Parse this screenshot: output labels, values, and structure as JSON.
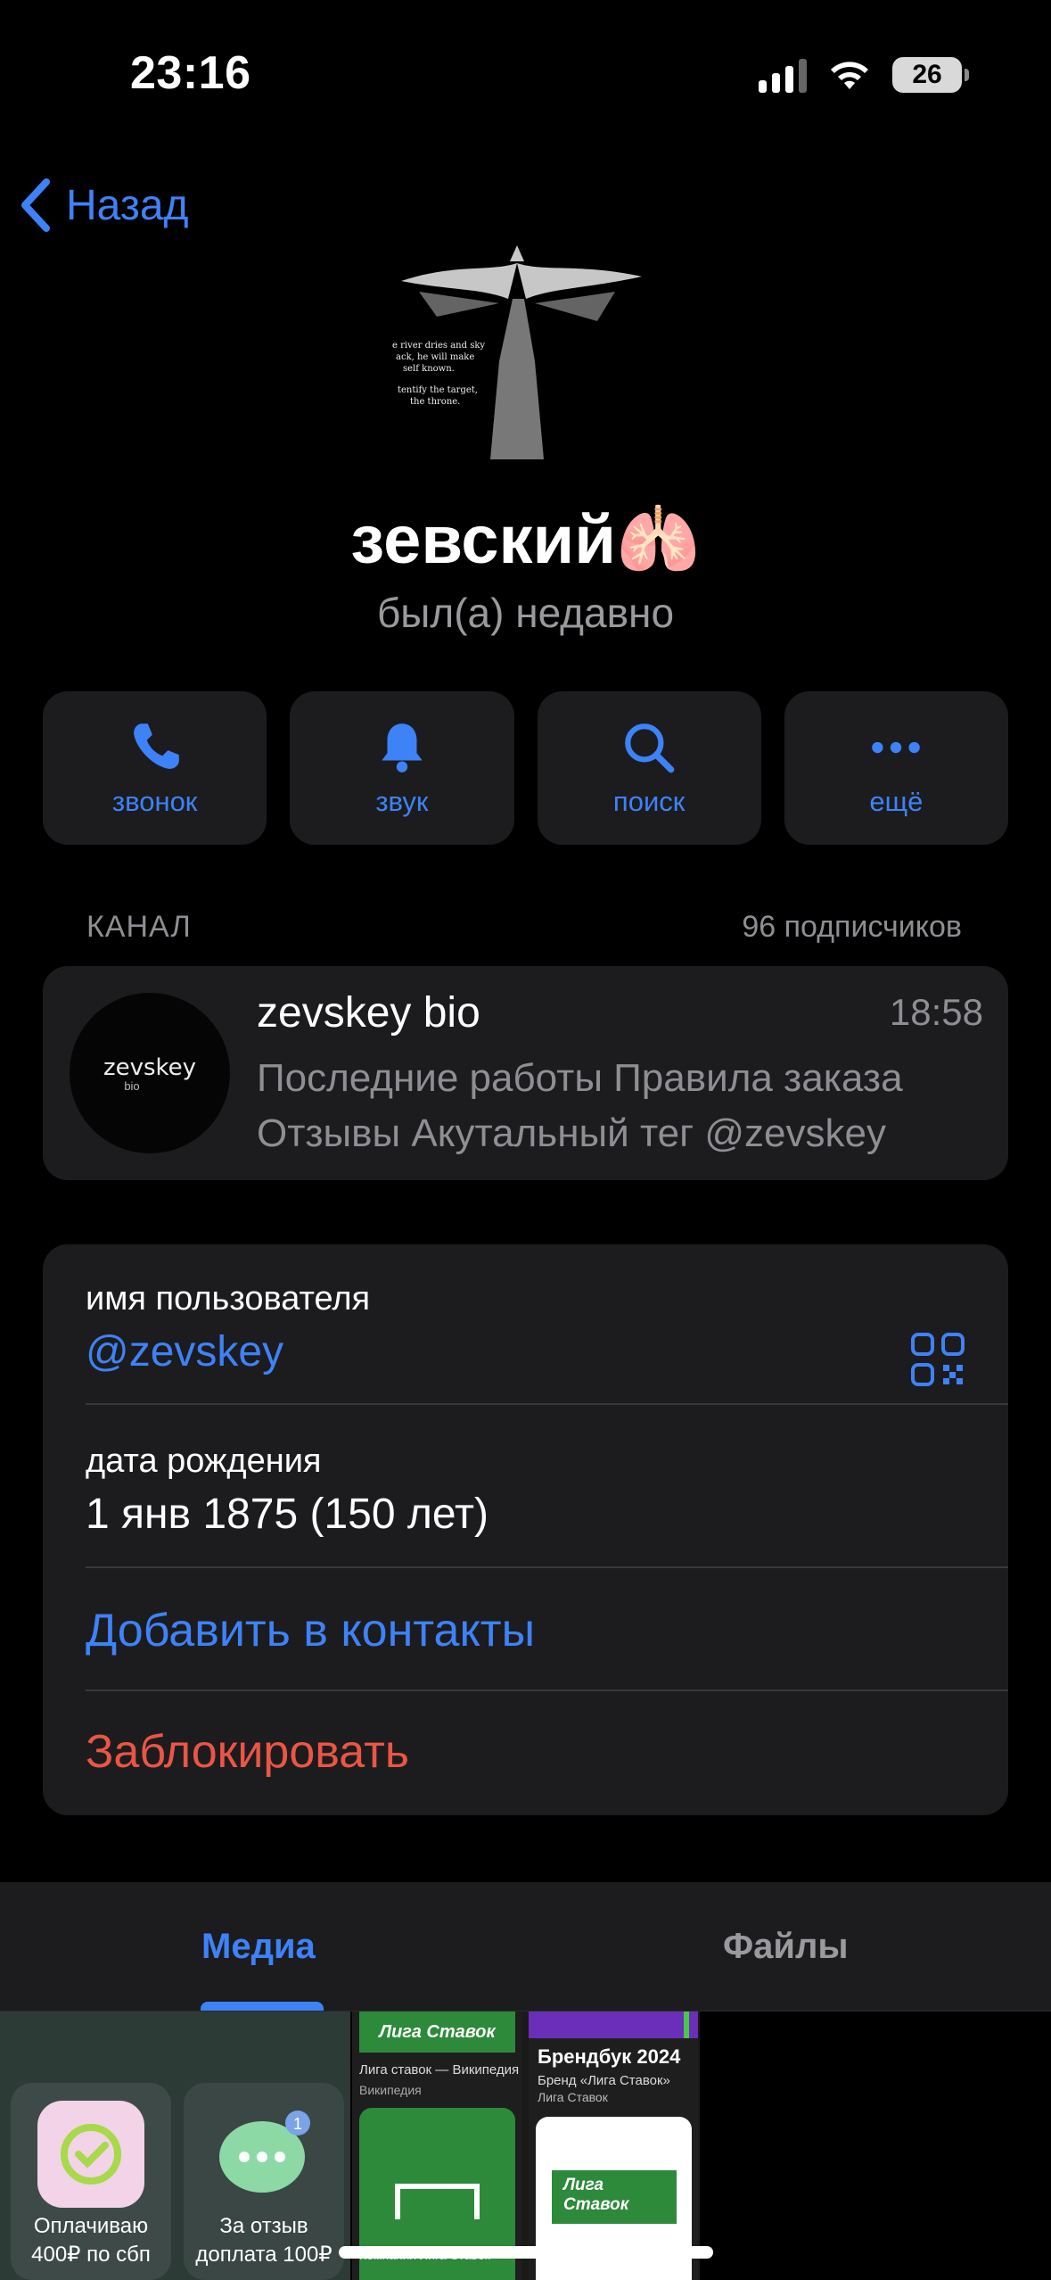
{
  "status_bar": {
    "time": "23:16",
    "battery": "26"
  },
  "nav": {
    "back_label": "Назад"
  },
  "profile": {
    "name": "зевский🫁",
    "status": "был(а) недавно",
    "avatar_text": [
      "e river dries and sky",
      "ack, he will make",
      "self known.",
      "tentify the target,",
      "the throne."
    ]
  },
  "actions": [
    {
      "label": "звонок",
      "icon": "phone-icon"
    },
    {
      "label": "звук",
      "icon": "bell-icon"
    },
    {
      "label": "поиск",
      "icon": "search-icon"
    },
    {
      "label": "ещё",
      "icon": "more-icon"
    }
  ],
  "channel": {
    "section_label": "КАНАЛ",
    "subscribers": "96 подписчиков",
    "title": "zevskey bio",
    "time": "18:58",
    "preview_line1": "Последние работы Правила заказа",
    "preview_line2": "Отзывы Акутальный тег @zevskey",
    "avatar_text": "zevskey",
    "avatar_sub": "bio"
  },
  "info": {
    "username_label": "имя пользователя",
    "username_value": "@zevskey",
    "birthday_label": "дата рождения",
    "birthday_value": "1 янв 1875 (150 лет)",
    "add_contact": "Добавить в контакты",
    "block": "Заблокировать"
  },
  "tabs": {
    "media": "Медиа",
    "files": "Файлы"
  },
  "media": {
    "tile1_caption1": "Оплачиваю 400₽ по сбп",
    "tile1_caption2": "За отзыв доплата 100₽",
    "tile1_badge": "1",
    "liga_logo": "Лига Ставок",
    "liga_wiki": "Лига ставок — Википедия",
    "liga_wiki_src": "Википедия",
    "liga_company": "Компания Лига Ставок —",
    "brand_title": "Брендбук 2024",
    "brand_sub": "Бренд «Лига Ставок»",
    "brand_src": "Лига Ставок"
  },
  "colors": {
    "accent": "#3e82f7",
    "danger": "#eb5545",
    "card": "#1c1c1e",
    "muted": "#8e8e93"
  }
}
